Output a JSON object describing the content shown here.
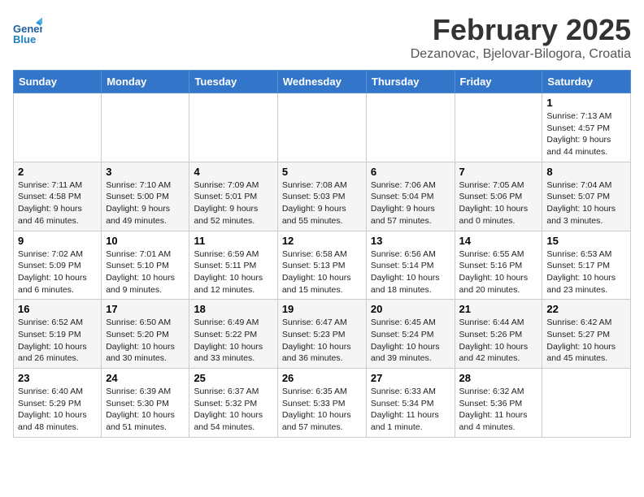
{
  "header": {
    "title": "February 2025",
    "subtitle": "Dezanovac, Bjelovar-Bilogora, Croatia",
    "logo_line1": "General",
    "logo_line2": "Blue"
  },
  "weekdays": [
    "Sunday",
    "Monday",
    "Tuesday",
    "Wednesday",
    "Thursday",
    "Friday",
    "Saturday"
  ],
  "weeks": [
    [
      {
        "day": "",
        "info": ""
      },
      {
        "day": "",
        "info": ""
      },
      {
        "day": "",
        "info": ""
      },
      {
        "day": "",
        "info": ""
      },
      {
        "day": "",
        "info": ""
      },
      {
        "day": "",
        "info": ""
      },
      {
        "day": "1",
        "info": "Sunrise: 7:13 AM\nSunset: 4:57 PM\nDaylight: 9 hours and 44 minutes."
      }
    ],
    [
      {
        "day": "2",
        "info": "Sunrise: 7:11 AM\nSunset: 4:58 PM\nDaylight: 9 hours and 46 minutes."
      },
      {
        "day": "3",
        "info": "Sunrise: 7:10 AM\nSunset: 5:00 PM\nDaylight: 9 hours and 49 minutes."
      },
      {
        "day": "4",
        "info": "Sunrise: 7:09 AM\nSunset: 5:01 PM\nDaylight: 9 hours and 52 minutes."
      },
      {
        "day": "5",
        "info": "Sunrise: 7:08 AM\nSunset: 5:03 PM\nDaylight: 9 hours and 55 minutes."
      },
      {
        "day": "6",
        "info": "Sunrise: 7:06 AM\nSunset: 5:04 PM\nDaylight: 9 hours and 57 minutes."
      },
      {
        "day": "7",
        "info": "Sunrise: 7:05 AM\nSunset: 5:06 PM\nDaylight: 10 hours and 0 minutes."
      },
      {
        "day": "8",
        "info": "Sunrise: 7:04 AM\nSunset: 5:07 PM\nDaylight: 10 hours and 3 minutes."
      }
    ],
    [
      {
        "day": "9",
        "info": "Sunrise: 7:02 AM\nSunset: 5:09 PM\nDaylight: 10 hours and 6 minutes."
      },
      {
        "day": "10",
        "info": "Sunrise: 7:01 AM\nSunset: 5:10 PM\nDaylight: 10 hours and 9 minutes."
      },
      {
        "day": "11",
        "info": "Sunrise: 6:59 AM\nSunset: 5:11 PM\nDaylight: 10 hours and 12 minutes."
      },
      {
        "day": "12",
        "info": "Sunrise: 6:58 AM\nSunset: 5:13 PM\nDaylight: 10 hours and 15 minutes."
      },
      {
        "day": "13",
        "info": "Sunrise: 6:56 AM\nSunset: 5:14 PM\nDaylight: 10 hours and 18 minutes."
      },
      {
        "day": "14",
        "info": "Sunrise: 6:55 AM\nSunset: 5:16 PM\nDaylight: 10 hours and 20 minutes."
      },
      {
        "day": "15",
        "info": "Sunrise: 6:53 AM\nSunset: 5:17 PM\nDaylight: 10 hours and 23 minutes."
      }
    ],
    [
      {
        "day": "16",
        "info": "Sunrise: 6:52 AM\nSunset: 5:19 PM\nDaylight: 10 hours and 26 minutes."
      },
      {
        "day": "17",
        "info": "Sunrise: 6:50 AM\nSunset: 5:20 PM\nDaylight: 10 hours and 30 minutes."
      },
      {
        "day": "18",
        "info": "Sunrise: 6:49 AM\nSunset: 5:22 PM\nDaylight: 10 hours and 33 minutes."
      },
      {
        "day": "19",
        "info": "Sunrise: 6:47 AM\nSunset: 5:23 PM\nDaylight: 10 hours and 36 minutes."
      },
      {
        "day": "20",
        "info": "Sunrise: 6:45 AM\nSunset: 5:24 PM\nDaylight: 10 hours and 39 minutes."
      },
      {
        "day": "21",
        "info": "Sunrise: 6:44 AM\nSunset: 5:26 PM\nDaylight: 10 hours and 42 minutes."
      },
      {
        "day": "22",
        "info": "Sunrise: 6:42 AM\nSunset: 5:27 PM\nDaylight: 10 hours and 45 minutes."
      }
    ],
    [
      {
        "day": "23",
        "info": "Sunrise: 6:40 AM\nSunset: 5:29 PM\nDaylight: 10 hours and 48 minutes."
      },
      {
        "day": "24",
        "info": "Sunrise: 6:39 AM\nSunset: 5:30 PM\nDaylight: 10 hours and 51 minutes."
      },
      {
        "day": "25",
        "info": "Sunrise: 6:37 AM\nSunset: 5:32 PM\nDaylight: 10 hours and 54 minutes."
      },
      {
        "day": "26",
        "info": "Sunrise: 6:35 AM\nSunset: 5:33 PM\nDaylight: 10 hours and 57 minutes."
      },
      {
        "day": "27",
        "info": "Sunrise: 6:33 AM\nSunset: 5:34 PM\nDaylight: 11 hours and 1 minute."
      },
      {
        "day": "28",
        "info": "Sunrise: 6:32 AM\nSunset: 5:36 PM\nDaylight: 11 hours and 4 minutes."
      },
      {
        "day": "",
        "info": ""
      }
    ]
  ]
}
